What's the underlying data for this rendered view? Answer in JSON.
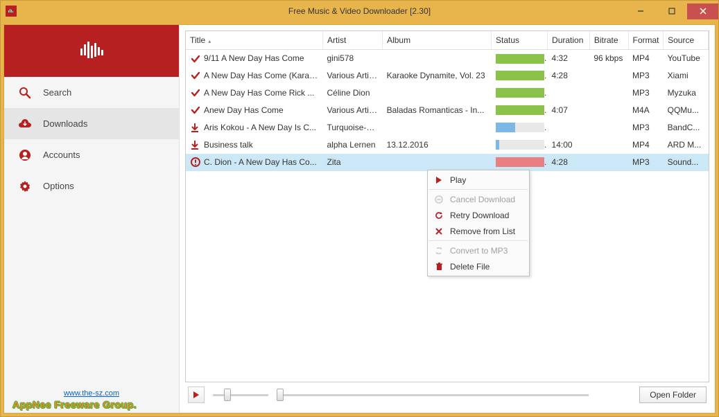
{
  "title": "Free Music & Video Downloader [2.30]",
  "sidebar": {
    "items": [
      {
        "label": "Search"
      },
      {
        "label": "Downloads"
      },
      {
        "label": "Accounts"
      },
      {
        "label": "Options"
      }
    ],
    "footer_link": "www.the-sz.com",
    "footer_group": "AppNee Freeware Group."
  },
  "table": {
    "headers": {
      "title": "Title",
      "artist": "Artist",
      "album": "Album",
      "status": "Status",
      "duration": "Duration",
      "bitrate": "Bitrate",
      "format": "Format",
      "source": "Source"
    },
    "rows": [
      {
        "icon": "check",
        "title": "9/11 A New Day Has Come",
        "artist": "gini578",
        "album": "",
        "status_color": "green",
        "status_pct": 100,
        "duration": "4:32",
        "bitrate": "96 kbps",
        "format": "MP4",
        "source": "YouTube"
      },
      {
        "icon": "check",
        "title": "A New Day Has Come (Karao...",
        "artist": "Various Artists",
        "album": "Karaoke Dynamite, Vol. 23",
        "status_color": "green",
        "status_pct": 100,
        "duration": "4:28",
        "bitrate": "",
        "format": "MP3",
        "source": "Xiami"
      },
      {
        "icon": "check",
        "title": "A New Day Has Come Rick ...",
        "artist": "Céline Dion",
        "album": "",
        "status_color": "green",
        "status_pct": 100,
        "duration": "",
        "bitrate": "",
        "format": "MP3",
        "source": "Myzuka"
      },
      {
        "icon": "check",
        "title": "Anew Day Has Come",
        "artist": "Various Artists",
        "album": "Baladas Romanticas - In...",
        "status_color": "green",
        "status_pct": 100,
        "duration": "4:07",
        "bitrate": "",
        "format": "M4A",
        "source": "QQMu..."
      },
      {
        "icon": "download",
        "title": "Aris Kokou - A New Day Is C...",
        "artist": "Turquoise-R...",
        "album": "",
        "status_color": "blue",
        "status_pct": 40,
        "duration": "",
        "bitrate": "",
        "format": "MP3",
        "source": "BandC..."
      },
      {
        "icon": "download",
        "title": "Business talk",
        "artist": "alpha Lernen",
        "album": "13.12.2016",
        "status_color": "blue",
        "status_pct": 8,
        "duration": "14:00",
        "bitrate": "",
        "format": "MP4",
        "source": "ARD M..."
      },
      {
        "icon": "error",
        "title": "C. Dion - A New Day Has Co...",
        "artist": "Zita",
        "album": "",
        "status_color": "red",
        "status_pct": 100,
        "duration": "4:28",
        "bitrate": "",
        "format": "MP3",
        "source": "Sound..."
      }
    ]
  },
  "context_menu": {
    "play": "Play",
    "cancel": "Cancel Download",
    "retry": "Retry Download",
    "remove": "Remove from List",
    "convert": "Convert to MP3",
    "delete": "Delete File"
  },
  "bottom": {
    "open_folder": "Open Folder"
  }
}
